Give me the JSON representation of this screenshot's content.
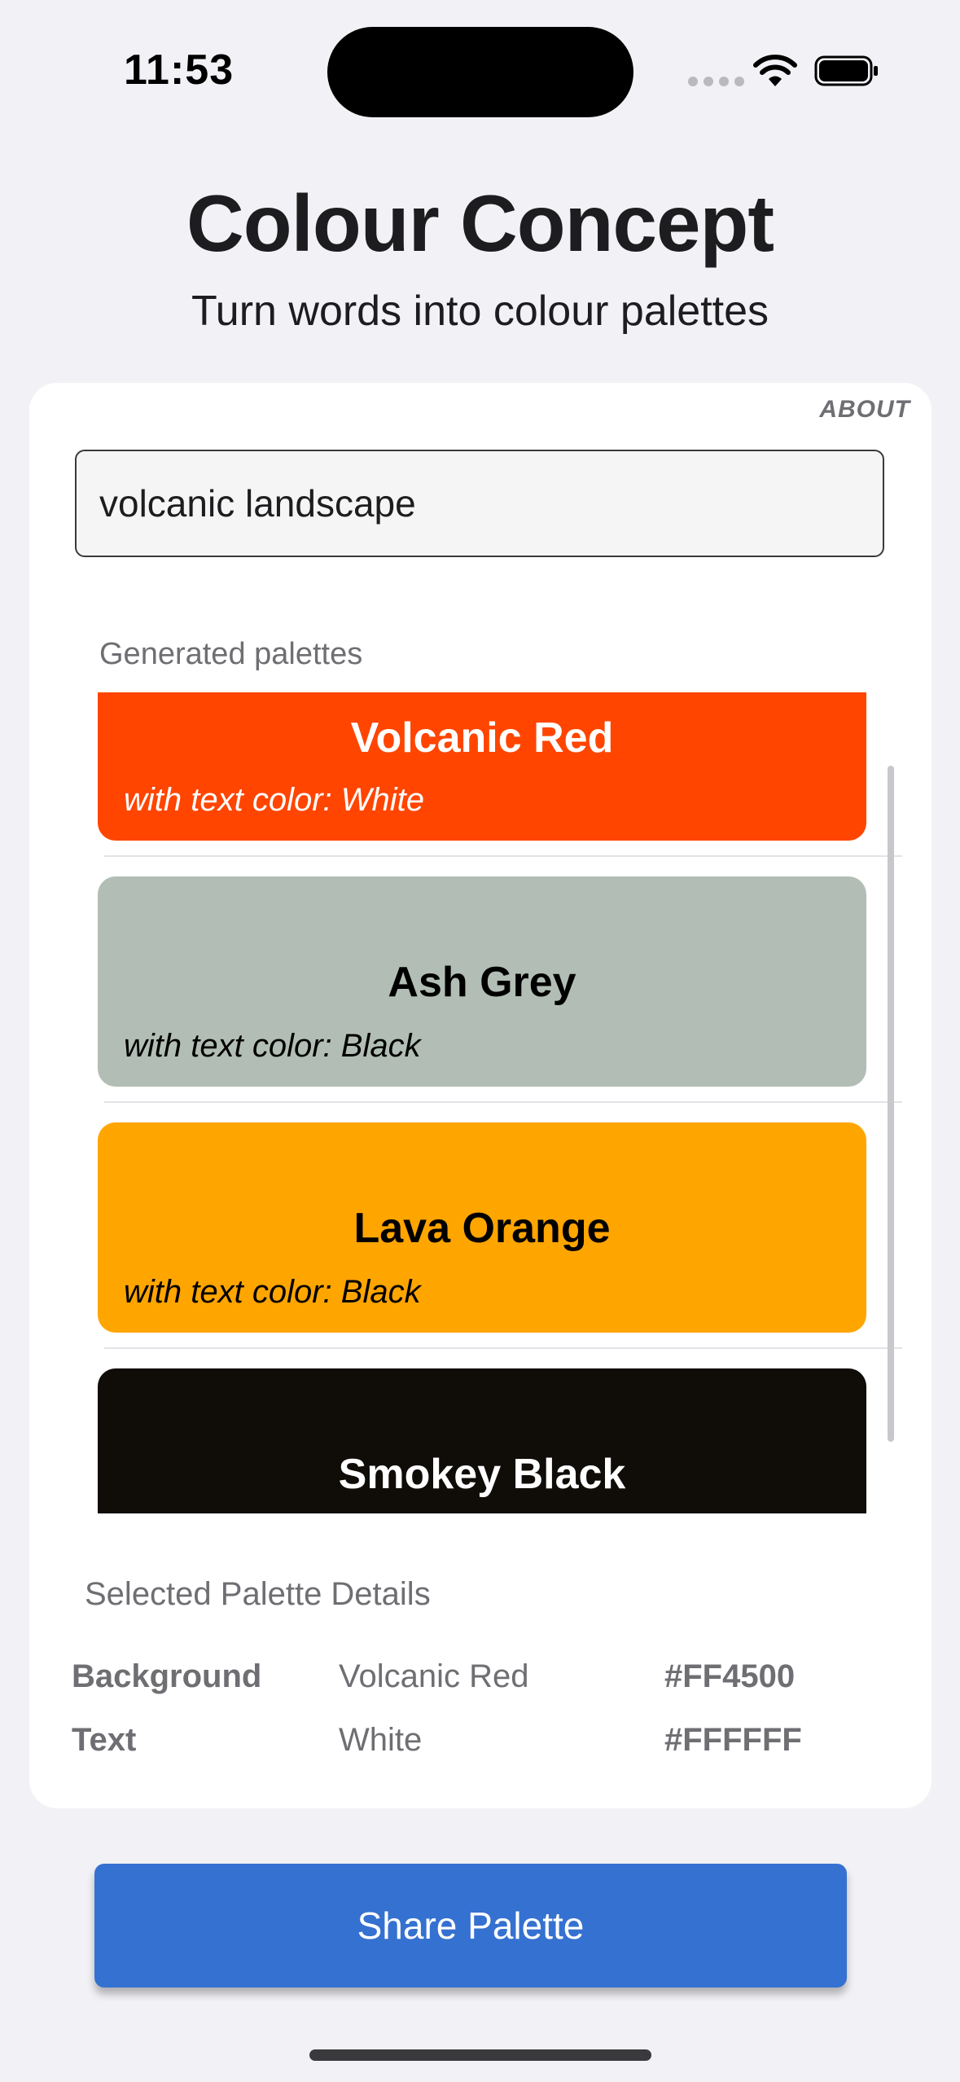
{
  "status_bar": {
    "time": "11:53"
  },
  "header": {
    "title": "Colour Concept",
    "subtitle": "Turn words into colour palettes"
  },
  "card": {
    "about_label": "ABOUT",
    "search": {
      "value": "volcanic landscape",
      "placeholder": ""
    },
    "palettes_label": "Generated palettes",
    "palettes": [
      {
        "name": "Volcanic Red",
        "subtitle": "with text color: White",
        "background": "#FF4500",
        "text_color": "#FFFFFF"
      },
      {
        "name": "Ash Grey",
        "subtitle": "with text color: Black",
        "background": "#B2BEB5",
        "text_color": "#000000"
      },
      {
        "name": "Lava Orange",
        "subtitle": "with text color: Black",
        "background": "#FFA500",
        "text_color": "#000000"
      },
      {
        "name": "Smokey Black",
        "subtitle": "",
        "background": "#100C08",
        "text_color": "#FFFFFF"
      }
    ],
    "details": {
      "title": "Selected Palette Details",
      "rows": [
        {
          "key": "Background",
          "name": "Volcanic Red",
          "hex": "#FF4500"
        },
        {
          "key": "Text",
          "name": "White",
          "hex": "#FFFFFF"
        }
      ]
    }
  },
  "share_button": {
    "label": "Share Palette"
  },
  "colors": {
    "accent": "#3571D0",
    "background": "#F2F2F6",
    "card": "#FFFFFF"
  },
  "icons": [
    "wifi-icon",
    "battery-icon",
    "signal-icon"
  ]
}
